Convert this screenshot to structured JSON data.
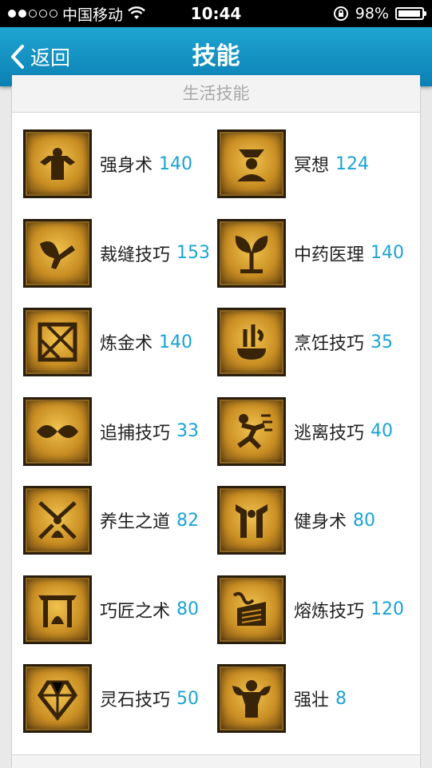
{
  "status_bar": {
    "carrier": "中国移动",
    "time": "10:44",
    "battery_text": "98%",
    "battery_level": 0.98,
    "signal_bars_filled": 2,
    "signal_bars_total": 5
  },
  "nav": {
    "back_label": "返回",
    "title": "技能"
  },
  "section": {
    "header": "生活技能"
  },
  "skills": [
    {
      "name": "强身术",
      "level": "140",
      "icon": "muscle-figure-icon"
    },
    {
      "name": "冥想",
      "level": "124",
      "icon": "meditation-icon"
    },
    {
      "name": "裁缝技巧",
      "level": "153",
      "icon": "scissors-icon"
    },
    {
      "name": "中药医理",
      "level": "140",
      "icon": "herb-leaf-icon"
    },
    {
      "name": "炼金术",
      "level": "140",
      "icon": "alchemy-icon"
    },
    {
      "name": "烹饪技巧",
      "level": "35",
      "icon": "cooking-icon"
    },
    {
      "name": "追捕技巧",
      "level": "33",
      "icon": "chain-links-icon"
    },
    {
      "name": "逃离技巧",
      "level": "40",
      "icon": "running-figure-icon"
    },
    {
      "name": "养生之道",
      "level": "82",
      "icon": "health-cultivation-icon"
    },
    {
      "name": "健身术",
      "level": "80",
      "icon": "fitness-icon"
    },
    {
      "name": "巧匠之术",
      "level": "80",
      "icon": "artisan-gate-icon"
    },
    {
      "name": "熔炼技巧",
      "level": "120",
      "icon": "smelting-icon"
    },
    {
      "name": "灵石技巧",
      "level": "50",
      "icon": "spirit-stone-icon"
    },
    {
      "name": "强壮",
      "level": "8",
      "icon": "strong-man-icon"
    }
  ]
}
